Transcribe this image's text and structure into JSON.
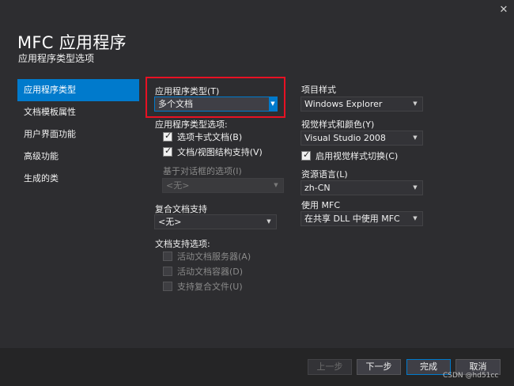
{
  "window": {
    "title": "MFC 应用程序",
    "subtitle": "应用程序类型选项",
    "close_glyph": "✕"
  },
  "nav": {
    "items": [
      {
        "label": "应用程序类型",
        "active": true
      },
      {
        "label": "文档模板属性",
        "active": false
      },
      {
        "label": "用户界面功能",
        "active": false
      },
      {
        "label": "高级功能",
        "active": false
      },
      {
        "label": "生成的类",
        "active": false
      }
    ]
  },
  "app_type": {
    "label": "应用程序类型(T)",
    "value": "多个文档",
    "options_label": "应用程序类型选项:",
    "tabbed_docs": {
      "label": "选项卡式文档(B)",
      "checked": true
    },
    "doc_view": {
      "label": "文档/视图结构支持(V)",
      "checked": true
    },
    "dialog_based_label": "基于对话框的选项(I)",
    "dialog_based_value": "<无>"
  },
  "compound": {
    "label": "复合文档支持",
    "value": "<无>",
    "doc_options_label": "文档支持选项:",
    "active_doc_server": {
      "label": "活动文档服务器(A)",
      "checked": false
    },
    "active_doc_container": {
      "label": "活动文档容器(D)",
      "checked": false
    },
    "compound_file": {
      "label": "支持复合文件(U)",
      "checked": false
    }
  },
  "project_style": {
    "label": "项目样式",
    "value": "Windows Explorer",
    "visual_style_label": "视觉样式和颜色(Y)",
    "visual_style_value": "Visual Studio 2008",
    "enable_switch": {
      "label": "启用视觉样式切换(C)",
      "checked": true
    },
    "resource_lang_label": "资源语言(L)",
    "resource_lang_value": "zh-CN",
    "use_mfc_label": "使用 MFC",
    "use_mfc_value": "在共享 DLL 中使用 MFC"
  },
  "buttons": {
    "prev": "上一步",
    "next": "下一步",
    "finish": "完成",
    "cancel": "取消"
  },
  "watermark": "CSDN @hd51cc",
  "colors": {
    "background": "#2d2d30",
    "accent": "#007acc",
    "highlight_box": "#e81123"
  }
}
